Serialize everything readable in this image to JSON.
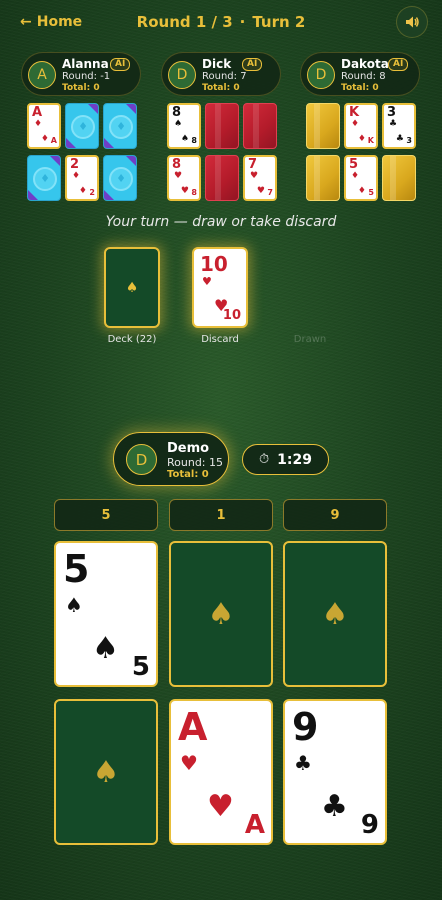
{
  "header": {
    "home_label": "Home",
    "round_text": "Round 1 / 3",
    "turn_text": "Turn 2"
  },
  "opponents": [
    {
      "initial": "A",
      "name": "Alanna",
      "tag": "AI",
      "round_text": "Round: -1",
      "total_text": "Total: 0"
    },
    {
      "initial": "D",
      "name": "Dick",
      "tag": "AI",
      "round_text": "Round: 7",
      "total_text": "Total: 0"
    },
    {
      "initial": "D",
      "name": "Dakota",
      "tag": "AI",
      "round_text": "Round: 8",
      "total_text": "Total: 0"
    }
  ],
  "opponent_cards": [
    [
      {
        "face": "A",
        "suit": "♦",
        "color": "red"
      },
      {
        "back": "cyan"
      },
      {
        "back": "cyan"
      },
      {
        "back": "cyan"
      },
      {
        "face": "2",
        "suit": "♦",
        "color": "red"
      },
      {
        "back": "cyan"
      }
    ],
    [
      {
        "face": "8",
        "suit": "♠",
        "color": "black"
      },
      {
        "back": "red"
      },
      {
        "back": "red"
      },
      {
        "face": "8",
        "suit": "♥",
        "color": "red"
      },
      {
        "back": "red"
      },
      {
        "face": "7",
        "suit": "♥",
        "color": "red"
      }
    ],
    [
      {
        "back": "gold"
      },
      {
        "face": "K",
        "suit": "♦",
        "color": "red"
      },
      {
        "face": "3",
        "suit": "♣",
        "color": "black"
      },
      {
        "back": "gold"
      },
      {
        "face": "5",
        "suit": "♦",
        "color": "red"
      },
      {
        "back": "gold"
      }
    ]
  ],
  "turn_message": "Your turn — draw or take discard",
  "deck": {
    "label": "Deck (22)",
    "back_symbol": "♠"
  },
  "discard": {
    "label": "Discard",
    "rank": "10",
    "suit": "♥"
  },
  "drawn_label": "Drawn",
  "player": {
    "initial": "D",
    "name": "Demo",
    "round_text": "Round: 15",
    "total_text": "Total: 0"
  },
  "timer": {
    "icon": "stopwatch-icon",
    "value": "1:29"
  },
  "column_sums": [
    "5",
    "1",
    "9"
  ],
  "player_cards": [
    {
      "face": "5",
      "suit": "♠",
      "color": "black"
    },
    {
      "back": "♠"
    },
    {
      "back": "♠"
    },
    {
      "back": "♠"
    },
    {
      "face": "A",
      "suit": "♥",
      "color": "red"
    },
    {
      "face": "9",
      "suit": "♣",
      "color": "black"
    }
  ],
  "colors": {
    "gold_accent": "#e8bf3a",
    "felt_green": "#1c431f",
    "card_back_green": "#144a28",
    "red_suit": "#c8202e"
  }
}
